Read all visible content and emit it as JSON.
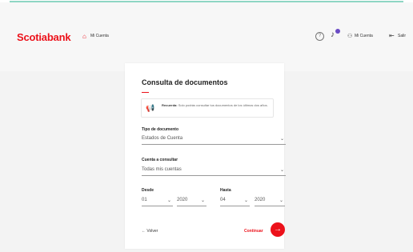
{
  "header": {
    "brand": "Scotiabank",
    "breadcrumb": "Mi Cuenta",
    "help_icon": "?",
    "user_label": "Mi Cuenta",
    "exit_label": "Salir"
  },
  "card": {
    "title": "Consulta de documentos",
    "notice": {
      "bold": "Recuerda:",
      "text": "Solo podrás consultar tus documentos de los últimos dos años."
    },
    "doc_type": {
      "label": "Tipo de documento",
      "value": "Estados de Cuenta"
    },
    "account": {
      "label": "Cuenta a consultar",
      "value": "Todas mis cuentas"
    },
    "from": {
      "label": "Desde",
      "month": "01",
      "year": "2020"
    },
    "to": {
      "label": "Hasta",
      "month": "04",
      "year": "2020"
    },
    "back_label": "Volver",
    "continue_label": "Continuar"
  },
  "colors": {
    "brand": "#ec111a",
    "accent_line": "#8fd6c4",
    "badge": "#6a4bc4"
  }
}
